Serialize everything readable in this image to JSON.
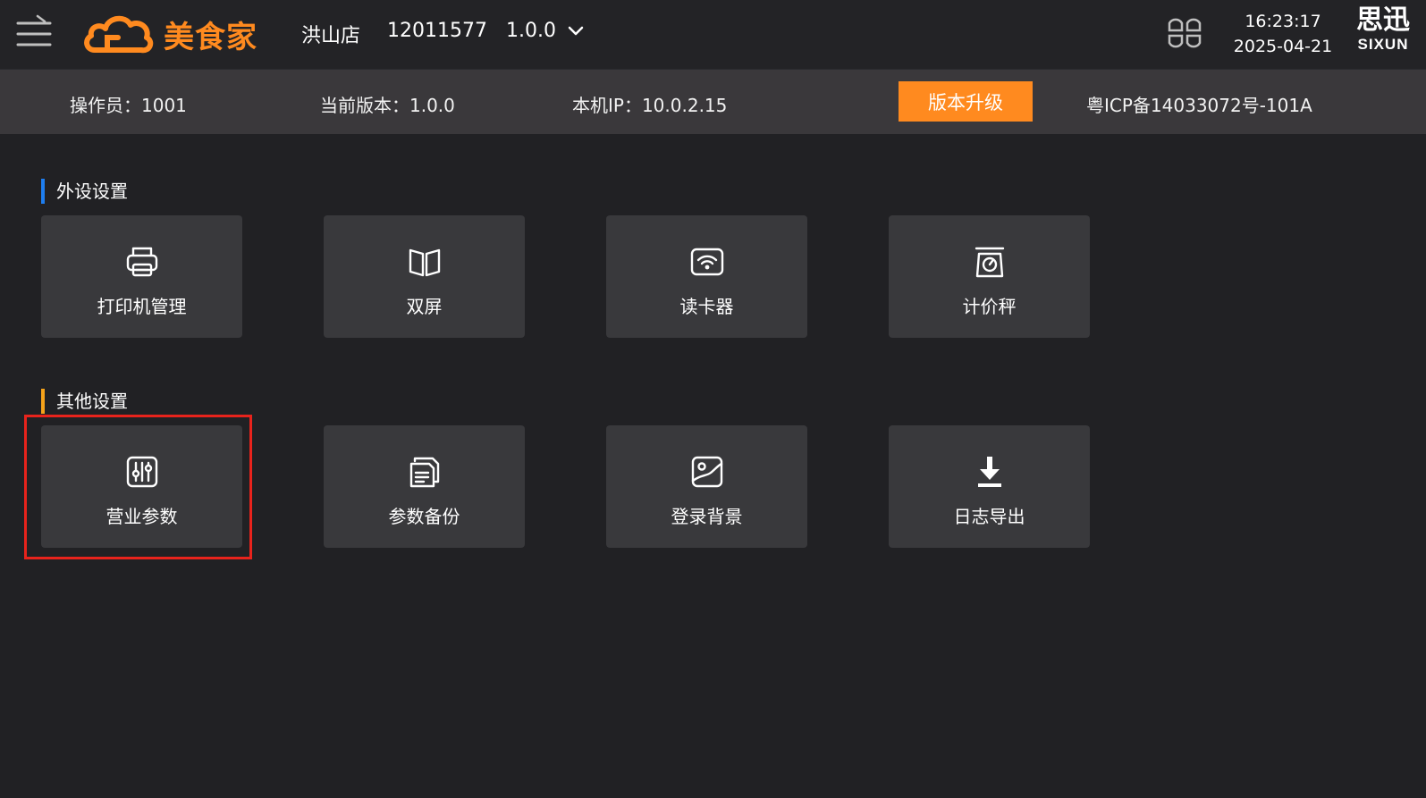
{
  "header": {
    "logo_text": "美食家",
    "store_name": "洪山店",
    "store_id": "12011577",
    "version": "1.0.0",
    "time": "16:23:17",
    "date": "2025-04-21",
    "brand_cn": "思迅",
    "brand_en": "SIXUN"
  },
  "infobar": {
    "operator": "操作员：1001",
    "current_version": "当前版本：1.0.0",
    "local_ip": "本机IP：10.0.2.15",
    "upgrade_label": "版本升级",
    "icp": "粤ICP备14033072号-101A"
  },
  "sections": [
    {
      "title": "外设设置",
      "accent": "#1e7ef0",
      "tiles": [
        {
          "label": "打印机管理",
          "icon": "printer-icon"
        },
        {
          "label": "双屏",
          "icon": "dual-screen-icon"
        },
        {
          "label": "读卡器",
          "icon": "card-reader-icon"
        },
        {
          "label": "计价秤",
          "icon": "scale-icon"
        }
      ]
    },
    {
      "title": "其他设置",
      "accent": "#f5a31a",
      "tiles": [
        {
          "label": "营业参数",
          "icon": "sliders-icon"
        },
        {
          "label": "参数备份",
          "icon": "backup-icon"
        },
        {
          "label": "登录背景",
          "icon": "image-icon"
        },
        {
          "label": "日志导出",
          "icon": "download-icon"
        }
      ]
    }
  ],
  "colors": {
    "brand_orange": "#ff8a1f",
    "highlight": "#e8231c"
  }
}
